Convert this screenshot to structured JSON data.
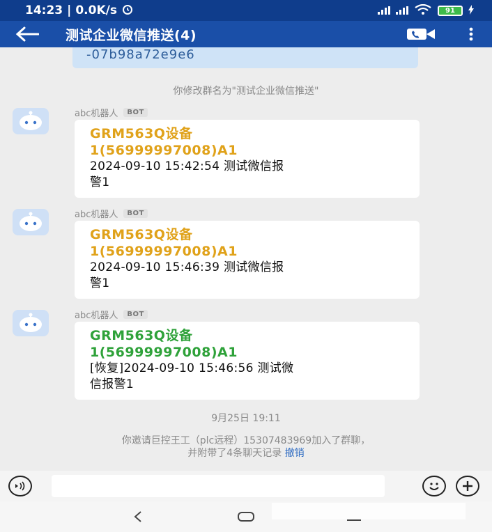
{
  "status": {
    "time": "14:23",
    "network_speed": "0.0K/s",
    "battery": "91"
  },
  "header": {
    "title": "测试企业微信推送(4)",
    "back_icon": "back-arrow-icon",
    "call_icon": "video-call-icon",
    "more_icon": "more-vertical-icon"
  },
  "chat": {
    "prev_message_tail": "-07b98a72e9e6",
    "rename_notice": "你修改群名为\"测试企业微信推送\"",
    "messages": [
      {
        "sender": "abc机器人",
        "tag": "BOT",
        "device_line1": "GRM563Q设备",
        "device_line2": "1(56999997008)A1",
        "detail_line1": "2024-09-10 15:42:54 测试微信报",
        "detail_line2": "警1",
        "color": "#e0a21a"
      },
      {
        "sender": "abc机器人",
        "tag": "BOT",
        "device_line1": "GRM563Q设备",
        "device_line2": "1(56999997008)A1",
        "detail_line1": "2024-09-10 15:46:39 测试微信报",
        "detail_line2": "警1",
        "color": "#e0a21a"
      },
      {
        "sender": "abc机器人",
        "tag": "BOT",
        "device_line1": "GRM563Q设备",
        "device_line2": "1(56999997008)A1",
        "detail_line1": "[恢复]2024-09-10 15:46:56 测试微",
        "detail_line2": "信报警1",
        "color": "#2fa23a"
      }
    ],
    "date_divider": "9月25日  19:11",
    "invite_line1": "你邀请巨控王工（plc远程）15307483969加入了群聊，",
    "invite_line2": "并附带了4条聊天记录",
    "undo_link": "撤销"
  },
  "input_bar": {
    "voice_icon": "voice-input-icon",
    "emoji_icon": "emoji-icon",
    "add_icon": "add-icon",
    "placeholder": ""
  },
  "nav": {
    "back_icon": "nav-back-icon",
    "home_icon": "nav-home-icon",
    "menu_icon": "nav-menu-icon"
  }
}
